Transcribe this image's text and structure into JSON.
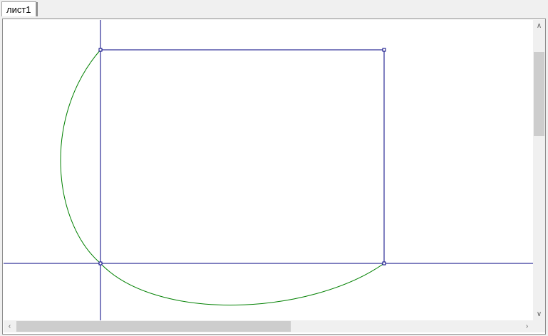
{
  "tabs": [
    {
      "label": "лист1",
      "active": true
    }
  ],
  "canvas": {
    "background": "#ffffff",
    "line_color": "#000080",
    "arc_color": "#008000"
  },
  "scrollbars": {
    "vertical": {
      "up_icon": "chevron-up-icon",
      "down_icon": "chevron-down-icon"
    },
    "horizontal": {
      "left_icon": "chevron-left-icon",
      "right_icon": "chevron-right-icon"
    }
  }
}
